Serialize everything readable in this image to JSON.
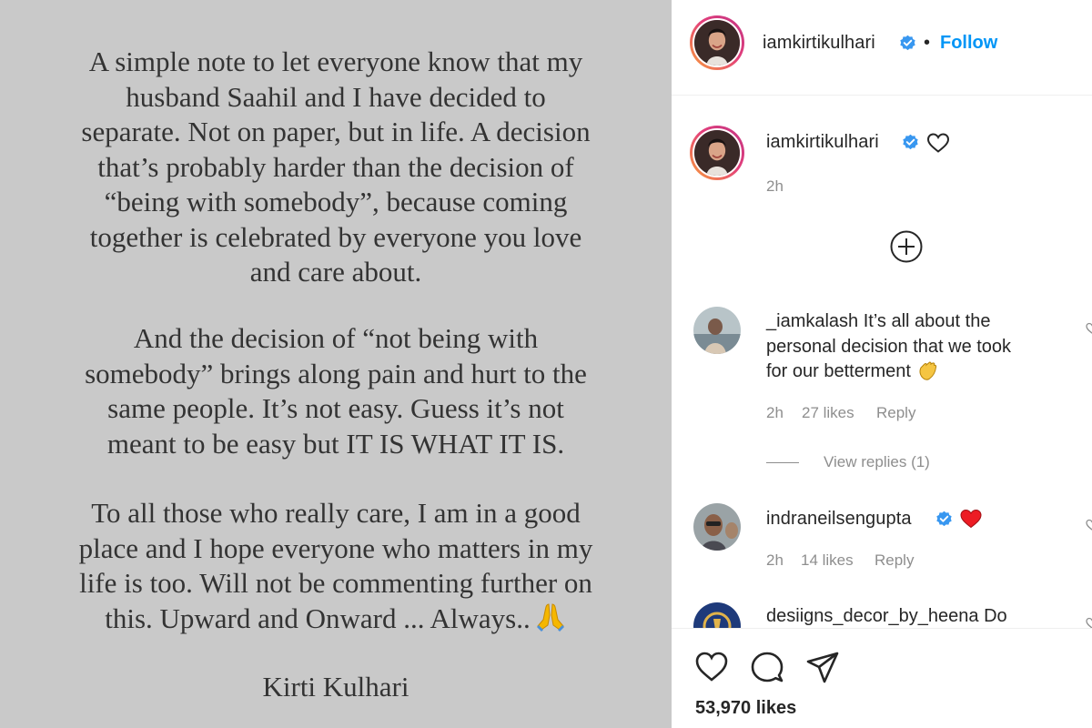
{
  "post_image": {
    "paragraph1": [
      "A simple note to let everyone know that my",
      "husband Saahil and I have decided to",
      "separate. Not on paper, but in life.  A decision",
      "that’s probably harder than the decision of",
      "“being with somebody”,  because coming",
      "together is celebrated by everyone you love",
      "and care about."
    ],
    "paragraph2": [
      "And the decision of “not being with",
      "somebody” brings along pain and hurt to the",
      "same people. It’s not easy. Guess it’s not",
      "meant to be easy but IT IS WHAT IT IS."
    ],
    "paragraph3": [
      "To all those who really care, I am in a good",
      "place and I hope everyone who matters in my",
      "life is too. Will not be commenting further on",
      "this. Upward and Onward ... Always.."
    ],
    "signature": "Kirti Kulhari"
  },
  "header": {
    "username": "iamkirtikulhari",
    "separator": "•",
    "follow_label": "Follow"
  },
  "caption": {
    "username": "iamkirtikulhari",
    "time": "2h"
  },
  "comments": [
    {
      "username": "_iamkalash",
      "text_line1": "It’s all about the",
      "text_line2": "personal decision that we took",
      "text_line3": "for our betterment",
      "time": "2h",
      "likes": "27 likes",
      "reply": "Reply",
      "view_replies": "View replies (1)"
    },
    {
      "username": "indraneilsengupta",
      "time": "2h",
      "likes": "14 likes",
      "reply": "Reply"
    },
    {
      "username": "desiigns_decor_by_heena",
      "text_start": "Do"
    }
  ],
  "footer": {
    "likes": "53,970 likes"
  },
  "colors": {
    "image_bg": "#c9c9c9",
    "follow_blue": "#0095f6",
    "verified_blue": "#3897f0",
    "heart_red": "#ed1c24",
    "muted_gray": "#8e8e8e"
  },
  "icons": [
    "verified-badge-icon",
    "heart-outline-icon",
    "add-circle-icon",
    "comment-icon",
    "share-icon",
    "clapping-hands-icon",
    "red-heart-icon",
    "praying-hands-icon"
  ]
}
